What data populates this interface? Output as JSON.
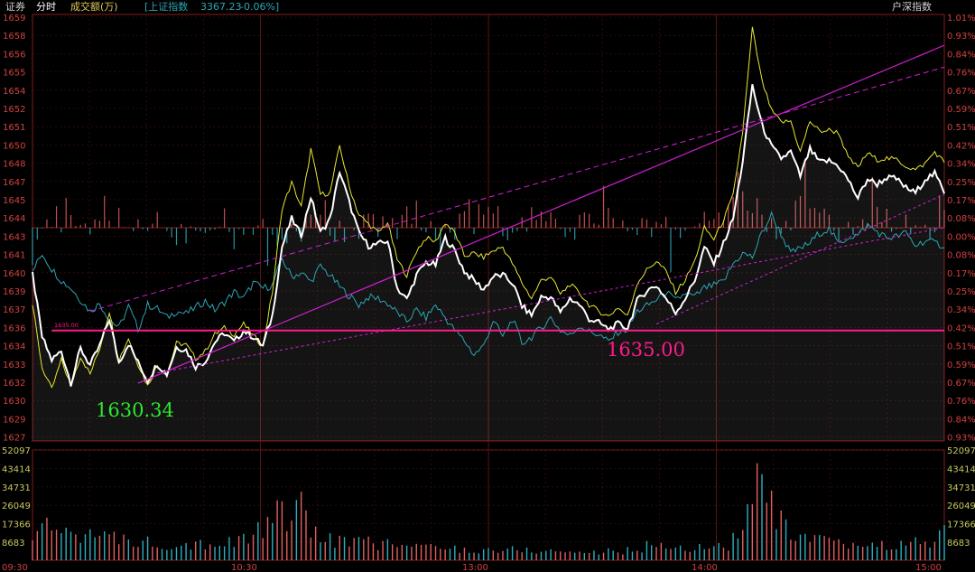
{
  "header": {
    "title": "证券",
    "mode": "分时",
    "volume_label": "成交额(万)",
    "index_label": "[上证指数",
    "index_value": "3367.23",
    "index_change": "-0.06%]",
    "right_label": "户深指数"
  },
  "colors": {
    "background": "#000000",
    "price_line": "#ffffff",
    "avg_line": "#e8e830",
    "index_line": "#2aa6b4",
    "trend_line": "#d21fd2",
    "support_line": "#ff1a8c",
    "up": "#e06060",
    "down": "#2ab0c0",
    "axis_text_left": "#d04040",
    "axis_text_right": "#d04040",
    "vol_axis_text": "#c8c860"
  },
  "annotations": {
    "low_label": "1630.34",
    "level_label": "1635.00",
    "level_tag": "1635.00"
  },
  "chart_data": {
    "type": "line",
    "price_axis_left": [
      "1659",
      "1658",
      "1656",
      "1655",
      "1654",
      "1652",
      "1651",
      "1650",
      "1648",
      "1647",
      "1645",
      "1644",
      "1643",
      "1641",
      "1640",
      "1639",
      "1637",
      "1636",
      "1634",
      "1633",
      "1632",
      "1630",
      "1629",
      "1627"
    ],
    "pct_axis_right": [
      "1.01%",
      "0.93%",
      "0.84%",
      "0.76%",
      "0.67%",
      "0.59%",
      "0.51%",
      "0.42%",
      "0.34%",
      "0.25%",
      "0.17%",
      "0.08%",
      "0.00%",
      "0.08%",
      "0.17%",
      "0.25%",
      "0.34%",
      "0.42%",
      "0.51%",
      "0.59%",
      "0.67%",
      "0.76%",
      "0.84%",
      "0.93%"
    ],
    "volume_axis": [
      "52097",
      "43414",
      "34731",
      "26049",
      "17366",
      "8683"
    ],
    "time_axis": [
      "09:30",
      "10:30",
      "13:00",
      "14:00",
      "15:00"
    ],
    "prev_close": 1643,
    "ylim": [
      1626.4,
      1659.6
    ],
    "volume_ylim": [
      0,
      52097
    ],
    "price_key": [
      [
        0,
        1639.4
      ],
      [
        4,
        1634.5
      ],
      [
        8,
        1632.7
      ],
      [
        12,
        1633.4
      ],
      [
        16,
        1630.9
      ],
      [
        20,
        1633.6
      ],
      [
        24,
        1632.3
      ],
      [
        28,
        1633.8
      ],
      [
        32,
        1635.9
      ],
      [
        36,
        1632.5
      ],
      [
        40,
        1634.0
      ],
      [
        44,
        1632.5
      ],
      [
        48,
        1631.1
      ],
      [
        52,
        1632.4
      ],
      [
        56,
        1631.6
      ],
      [
        60,
        1633.7
      ],
      [
        64,
        1633.5
      ],
      [
        68,
        1632.2
      ],
      [
        72,
        1632.6
      ],
      [
        76,
        1634.1
      ],
      [
        80,
        1634.8
      ],
      [
        84,
        1634.1
      ],
      [
        88,
        1635.0
      ],
      [
        92,
        1634.5
      ],
      [
        96,
        1633.8
      ],
      [
        100,
        1636.2
      ],
      [
        104,
        1641.5
      ],
      [
        108,
        1643.7
      ],
      [
        112,
        1642.4
      ],
      [
        116,
        1645.4
      ],
      [
        120,
        1642.6
      ],
      [
        124,
        1643.7
      ],
      [
        128,
        1647.4
      ],
      [
        132,
        1645.0
      ],
      [
        136,
        1642.6
      ],
      [
        140,
        1641.6
      ],
      [
        144,
        1641.7
      ],
      [
        148,
        1642.0
      ],
      [
        152,
        1638.3
      ],
      [
        156,
        1637.4
      ],
      [
        160,
        1639.3
      ],
      [
        164,
        1640.3
      ],
      [
        168,
        1640.1
      ],
      [
        172,
        1642.2
      ],
      [
        176,
        1641.2
      ],
      [
        180,
        1639.6
      ],
      [
        184,
        1638.9
      ],
      [
        188,
        1638.2
      ],
      [
        192,
        1639.2
      ],
      [
        196,
        1639.3
      ],
      [
        200,
        1638.7
      ],
      [
        204,
        1636.9
      ],
      [
        208,
        1636.2
      ],
      [
        212,
        1637.6
      ],
      [
        216,
        1637.6
      ],
      [
        220,
        1636.4
      ],
      [
        224,
        1637.5
      ],
      [
        228,
        1637.0
      ],
      [
        232,
        1635.9
      ],
      [
        236,
        1635.6
      ],
      [
        240,
        1635.1
      ],
      [
        244,
        1635.5
      ],
      [
        248,
        1635.2
      ],
      [
        252,
        1637.3
      ],
      [
        256,
        1638.1
      ],
      [
        260,
        1638.5
      ],
      [
        264,
        1637.5
      ],
      [
        268,
        1636.4
      ],
      [
        272,
        1637.5
      ],
      [
        276,
        1638.9
      ],
      [
        280,
        1641.5
      ],
      [
        284,
        1640.2
      ],
      [
        288,
        1641.8
      ],
      [
        292,
        1643.7
      ],
      [
        296,
        1648.2
      ],
      [
        300,
        1654.1
      ],
      [
        304,
        1651.0
      ],
      [
        308,
        1649.3
      ],
      [
        312,
        1648.4
      ],
      [
        316,
        1648.9
      ],
      [
        320,
        1647.0
      ],
      [
        324,
        1649.1
      ],
      [
        328,
        1648.1
      ],
      [
        332,
        1648.2
      ],
      [
        336,
        1647.8
      ],
      [
        340,
        1646.7
      ],
      [
        344,
        1645.3
      ],
      [
        348,
        1646.8
      ],
      [
        352,
        1646.4
      ],
      [
        356,
        1646.9
      ],
      [
        360,
        1646.8
      ],
      [
        364,
        1646.1
      ],
      [
        368,
        1645.7
      ],
      [
        372,
        1646.8
      ],
      [
        376,
        1647.2
      ],
      [
        380,
        1645.8
      ]
    ],
    "avg_key": [
      [
        0,
        1637.0
      ],
      [
        4,
        1632.1
      ],
      [
        8,
        1630.4
      ],
      [
        12,
        1632.7
      ],
      [
        16,
        1630.7
      ],
      [
        20,
        1633.0
      ],
      [
        24,
        1631.6
      ],
      [
        28,
        1633.6
      ],
      [
        32,
        1636.5
      ],
      [
        36,
        1632.7
      ],
      [
        40,
        1634.4
      ],
      [
        44,
        1632.4
      ],
      [
        48,
        1630.7
      ],
      [
        52,
        1632.3
      ],
      [
        56,
        1631.6
      ],
      [
        60,
        1634.0
      ],
      [
        64,
        1633.9
      ],
      [
        68,
        1632.8
      ],
      [
        72,
        1633.4
      ],
      [
        76,
        1634.7
      ],
      [
        80,
        1635.2
      ],
      [
        84,
        1634.7
      ],
      [
        88,
        1635.5
      ],
      [
        92,
        1634.6
      ],
      [
        96,
        1633.8
      ],
      [
        100,
        1638.0
      ],
      [
        104,
        1644.5
      ],
      [
        108,
        1646.5
      ],
      [
        112,
        1644.6
      ],
      [
        116,
        1649.1
      ],
      [
        120,
        1645.6
      ],
      [
        124,
        1645.7
      ],
      [
        128,
        1649.4
      ],
      [
        132,
        1646.2
      ],
      [
        136,
        1644.0
      ],
      [
        140,
        1643.3
      ],
      [
        144,
        1642.6
      ],
      [
        148,
        1643.4
      ],
      [
        152,
        1640.5
      ],
      [
        156,
        1639.3
      ],
      [
        160,
        1641.2
      ],
      [
        164,
        1642.2
      ],
      [
        168,
        1641.9
      ],
      [
        172,
        1643.4
      ],
      [
        176,
        1642.6
      ],
      [
        180,
        1640.8
      ],
      [
        184,
        1641.0
      ],
      [
        188,
        1640.7
      ],
      [
        192,
        1641.2
      ],
      [
        196,
        1641.5
      ],
      [
        200,
        1640.2
      ],
      [
        204,
        1638.7
      ],
      [
        208,
        1637.5
      ],
      [
        212,
        1638.9
      ],
      [
        216,
        1639.2
      ],
      [
        220,
        1637.8
      ],
      [
        224,
        1638.6
      ],
      [
        228,
        1637.9
      ],
      [
        232,
        1637.0
      ],
      [
        236,
        1636.5
      ],
      [
        240,
        1636.1
      ],
      [
        244,
        1636.8
      ],
      [
        248,
        1636.1
      ],
      [
        252,
        1638.7
      ],
      [
        256,
        1639.7
      ],
      [
        260,
        1640.4
      ],
      [
        264,
        1639.6
      ],
      [
        268,
        1638.0
      ],
      [
        272,
        1638.9
      ],
      [
        276,
        1640.4
      ],
      [
        280,
        1643.0
      ],
      [
        284,
        1642.1
      ],
      [
        288,
        1643.6
      ],
      [
        292,
        1645.5
      ],
      [
        296,
        1650.5
      ],
      [
        300,
        1658.5
      ],
      [
        304,
        1654.4
      ],
      [
        308,
        1652.1
      ],
      [
        312,
        1651.2
      ],
      [
        316,
        1651.3
      ],
      [
        320,
        1648.9
      ],
      [
        324,
        1651.3
      ],
      [
        328,
        1650.5
      ],
      [
        332,
        1650.6
      ],
      [
        336,
        1650.4
      ],
      [
        340,
        1648.4
      ],
      [
        344,
        1647.7
      ],
      [
        348,
        1648.8
      ],
      [
        352,
        1648.3
      ],
      [
        356,
        1648.4
      ],
      [
        360,
        1648.3
      ],
      [
        364,
        1647.8
      ],
      [
        368,
        1647.5
      ],
      [
        372,
        1648.0
      ],
      [
        376,
        1648.9
      ],
      [
        380,
        1648.1
      ]
    ],
    "index_key": [
      [
        0,
        1639.6
      ],
      [
        4,
        1641.0
      ],
      [
        8,
        1639.8
      ],
      [
        12,
        1638.9
      ],
      [
        16,
        1638.3
      ],
      [
        20,
        1637.4
      ],
      [
        24,
        1636.5
      ],
      [
        28,
        1637.1
      ],
      [
        32,
        1635.9
      ],
      [
        36,
        1635.2
      ],
      [
        40,
        1636.9
      ],
      [
        44,
        1635.1
      ],
      [
        48,
        1637.0
      ],
      [
        52,
        1636.7
      ],
      [
        56,
        1636.0
      ],
      [
        60,
        1636.5
      ],
      [
        64,
        1636.3
      ],
      [
        68,
        1636.8
      ],
      [
        72,
        1637.3
      ],
      [
        76,
        1636.6
      ],
      [
        80,
        1637.2
      ],
      [
        84,
        1638.0
      ],
      [
        88,
        1637.5
      ],
      [
        92,
        1638.7
      ],
      [
        96,
        1638.3
      ],
      [
        100,
        1638.5
      ],
      [
        104,
        1640.6
      ],
      [
        108,
        1639.2
      ],
      [
        112,
        1639.5
      ],
      [
        116,
        1638.8
      ],
      [
        120,
        1640.0
      ],
      [
        124,
        1639.3
      ],
      [
        128,
        1638.4
      ],
      [
        132,
        1637.7
      ],
      [
        136,
        1637.0
      ],
      [
        140,
        1637.6
      ],
      [
        144,
        1637.5
      ],
      [
        148,
        1637.1
      ],
      [
        152,
        1636.4
      ],
      [
        156,
        1635.7
      ],
      [
        160,
        1636.6
      ],
      [
        164,
        1636.0
      ],
      [
        168,
        1637.0
      ],
      [
        172,
        1636.0
      ],
      [
        176,
        1635.0
      ],
      [
        180,
        1634.2
      ],
      [
        184,
        1633.1
      ],
      [
        188,
        1633.8
      ],
      [
        192,
        1635.8
      ],
      [
        196,
        1634.5
      ],
      [
        200,
        1635.9
      ],
      [
        204,
        1634.0
      ],
      [
        208,
        1634.5
      ],
      [
        212,
        1635.2
      ],
      [
        216,
        1636.0
      ],
      [
        220,
        1635.0
      ],
      [
        224,
        1634.6
      ],
      [
        228,
        1635.4
      ],
      [
        232,
        1634.9
      ],
      [
        236,
        1634.7
      ],
      [
        240,
        1634.1
      ],
      [
        244,
        1634.9
      ],
      [
        248,
        1635.1
      ],
      [
        252,
        1636.5
      ],
      [
        256,
        1636.9
      ],
      [
        260,
        1637.4
      ],
      [
        264,
        1638.0
      ],
      [
        268,
        1637.3
      ],
      [
        272,
        1637.9
      ],
      [
        276,
        1637.6
      ],
      [
        280,
        1638.3
      ],
      [
        284,
        1638.5
      ],
      [
        288,
        1638.8
      ],
      [
        292,
        1640.2
      ],
      [
        296,
        1641.0
      ],
      [
        300,
        1640.7
      ],
      [
        304,
        1642.6
      ],
      [
        308,
        1644.0
      ],
      [
        312,
        1642.5
      ],
      [
        316,
        1641.0
      ],
      [
        320,
        1641.4
      ],
      [
        324,
        1641.8
      ],
      [
        328,
        1642.6
      ],
      [
        332,
        1642.9
      ],
      [
        336,
        1641.7
      ],
      [
        340,
        1642.3
      ],
      [
        344,
        1642.4
      ],
      [
        348,
        1643.2
      ],
      [
        352,
        1642.7
      ],
      [
        356,
        1642.2
      ],
      [
        360,
        1642.3
      ],
      [
        364,
        1642.6
      ],
      [
        368,
        1641.6
      ],
      [
        372,
        1642.0
      ],
      [
        376,
        1641.8
      ],
      [
        380,
        1641.6
      ]
    ],
    "volume_key": [
      [
        0,
        14000
      ],
      [
        10,
        16500
      ],
      [
        20,
        15000
      ],
      [
        30,
        11000
      ],
      [
        40,
        10500
      ],
      [
        50,
        9000
      ],
      [
        60,
        8500
      ],
      [
        70,
        9000
      ],
      [
        80,
        8000
      ],
      [
        90,
        12000
      ],
      [
        100,
        18000
      ],
      [
        104,
        27000
      ],
      [
        108,
        21000
      ],
      [
        112,
        25000
      ],
      [
        116,
        17000
      ],
      [
        120,
        12000
      ],
      [
        130,
        9500
      ],
      [
        140,
        9000
      ],
      [
        150,
        8000
      ],
      [
        160,
        7000
      ],
      [
        170,
        6500
      ],
      [
        180,
        5500
      ],
      [
        190,
        5000
      ],
      [
        200,
        5500
      ],
      [
        210,
        5000
      ],
      [
        220,
        4500
      ],
      [
        230,
        4000
      ],
      [
        240,
        4500
      ],
      [
        250,
        5000
      ],
      [
        260,
        8500
      ],
      [
        270,
        6000
      ],
      [
        280,
        6500
      ],
      [
        290,
        8000
      ],
      [
        296,
        16000
      ],
      [
        300,
        33000
      ],
      [
        304,
        40000
      ],
      [
        308,
        26000
      ],
      [
        316,
        12000
      ],
      [
        330,
        9000
      ],
      [
        340,
        8000
      ],
      [
        350,
        7500
      ],
      [
        360,
        8000
      ],
      [
        370,
        9000
      ],
      [
        380,
        13000
      ]
    ],
    "deviation_key": [
      [
        0,
        0.0
      ],
      [
        10,
        0.15
      ],
      [
        20,
        -0.1
      ],
      [
        30,
        0.35
      ],
      [
        40,
        -0.05
      ],
      [
        50,
        0.2
      ],
      [
        60,
        -0.15
      ],
      [
        70,
        0.05
      ],
      [
        80,
        0.25
      ],
      [
        90,
        -0.2
      ],
      [
        100,
        0.0
      ],
      [
        105,
        -0.3
      ],
      [
        110,
        0.1
      ],
      [
        120,
        0.4
      ],
      [
        130,
        -0.25
      ],
      [
        140,
        0.15
      ],
      [
        150,
        -0.05
      ],
      [
        160,
        0.3
      ],
      [
        170,
        -0.2
      ],
      [
        180,
        0.05
      ],
      [
        190,
        0.35
      ],
      [
        200,
        -0.15
      ],
      [
        210,
        0.2
      ],
      [
        220,
        -0.1
      ],
      [
        230,
        0.1
      ],
      [
        240,
        0.3
      ],
      [
        250,
        -0.2
      ],
      [
        260,
        0.05
      ],
      [
        270,
        -0.15
      ],
      [
        280,
        0.2
      ],
      [
        290,
        0.35
      ],
      [
        300,
        0.5
      ],
      [
        310,
        -0.2
      ],
      [
        320,
        0.45
      ],
      [
        330,
        0.15
      ],
      [
        340,
        -0.1
      ],
      [
        350,
        0.3
      ],
      [
        360,
        0.05
      ],
      [
        370,
        -0.25
      ],
      [
        380,
        0.1
      ]
    ]
  }
}
